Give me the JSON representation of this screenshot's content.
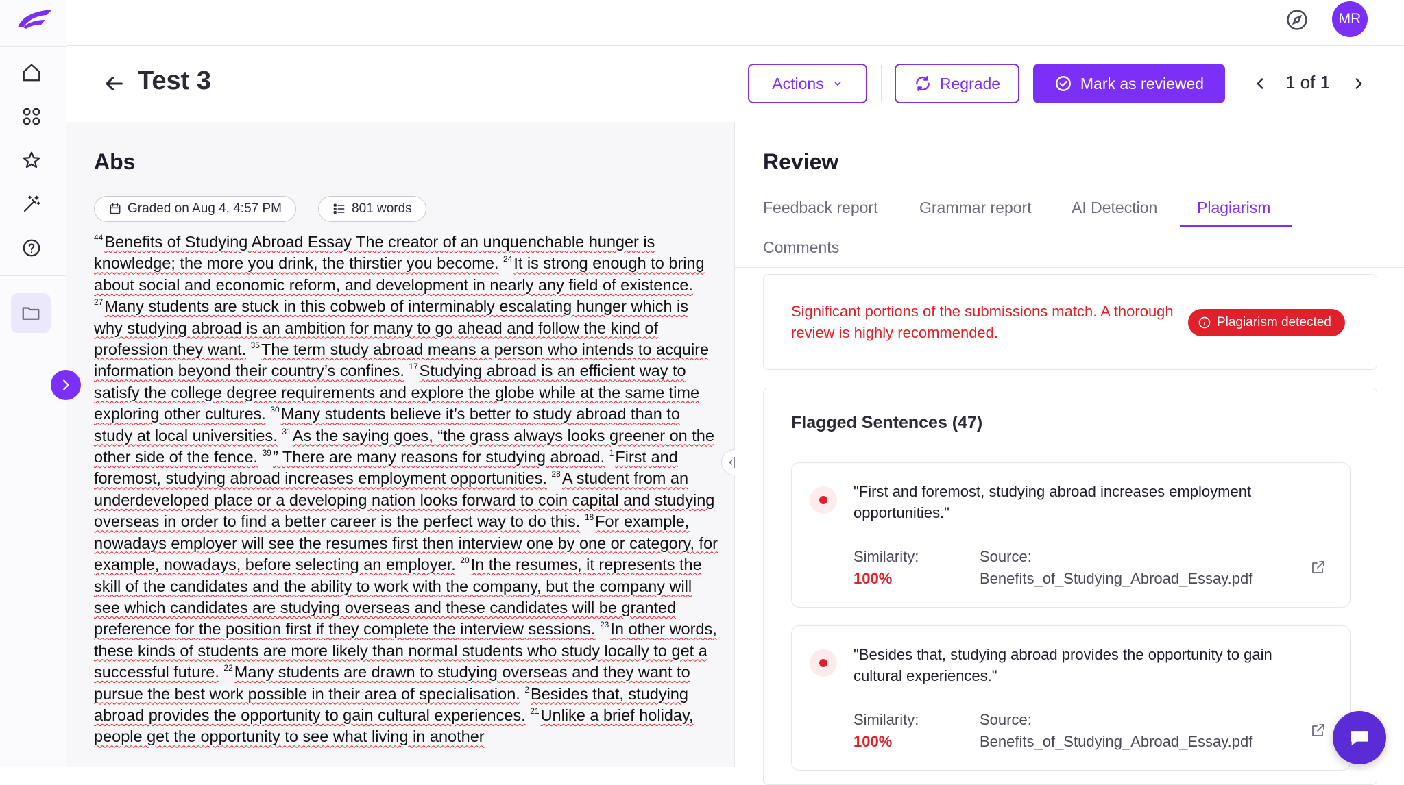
{
  "user": {
    "initials": "MR"
  },
  "header": {
    "title": "Test 3",
    "actions_label": "Actions",
    "regrade_label": "Regrade",
    "mark_reviewed_label": "Mark as reviewed",
    "pager": "1 of 1"
  },
  "essay": {
    "title": "Abs",
    "graded": "Graded on Aug 4, 4:57 PM",
    "words": "801 words",
    "segments": [
      {
        "n": "44",
        "t": "Benefits of Studying Abroad Essay The creator of an unquenchable hunger is knowledge; the more you drink, the thirstier you become."
      },
      {
        "n": "24",
        "t": "It is strong enough to bring about social and economic reform, and development in nearly any field of existence."
      },
      {
        "n": "27",
        "t": "Many students are stuck in this cobweb of interminably escalating hunger which is why studying abroad is an ambition for many to go ahead and follow the kind of profession they want."
      },
      {
        "n": "35",
        "t": "The term study abroad means a person who intends to acquire information beyond their country’s confines."
      },
      {
        "n": "17",
        "t": "Studying abroad is an efficient way to satisfy the college degree requirements and explore the globe while at the same time exploring other cultures."
      },
      {
        "n": "30",
        "t": "Many students believe it’s better to study abroad than to study at local universities."
      },
      {
        "n": "31",
        "t": "As the saying goes, “the grass always looks greener on the other side of the fence."
      },
      {
        "n": "39",
        "t": "” There are many reasons for studying abroad."
      },
      {
        "n": "1",
        "t": "First and foremost, studying abroad increases employment opportunities."
      },
      {
        "n": "28",
        "t": "A student from an underdeveloped place or a developing nation looks forward to coin capital and studying overseas in order to find a better career is the perfect way to do this."
      },
      {
        "n": "18",
        "t": "For example, nowadays employer will see the resumes first then interview one by one or category, for example, nowadays, before selecting an employer."
      },
      {
        "n": "20",
        "t": "In the resumes, it represents the skill of the candidates and the ability to work with the company, but the company will see which candidates are studying overseas and these candidates will be granted preference for the position first if they complete the interview sessions."
      },
      {
        "n": "23",
        "t": "In other words, these kinds of students are more likely than normal students who study locally to get a successful future."
      },
      {
        "n": "22",
        "t": "Many students are drawn to studying overseas and they want to pursue the best work possible in their area of specialisation."
      },
      {
        "n": "2",
        "t": "Besides that, studying abroad provides the opportunity to gain cultural experiences."
      },
      {
        "n": "21",
        "t": "Unlike a brief holiday, people get the opportunity to see what living in another"
      }
    ]
  },
  "review": {
    "title": "Review",
    "tabs": [
      "Feedback report",
      "Grammar report",
      "AI Detection",
      "Plagiarism",
      "Comments"
    ],
    "active_tab": "Plagiarism",
    "alert": {
      "text": "Significant portions of the submissions match. A thorough review is highly recommended.",
      "badge": "Plagiarism detected"
    },
    "flagged_title": "Flagged Sentences (47)",
    "flagged": [
      {
        "quote": "\"First and foremost, studying abroad increases employment opportunities.\"",
        "similarity_label": "Similarity:",
        "similarity": "100%",
        "source_label": "Source:",
        "source": "Benefits_of_Studying_Abroad_Essay.pdf"
      },
      {
        "quote": "\"Besides that, studying abroad provides the opportunity to gain cultural experiences.\"",
        "similarity_label": "Similarity:",
        "similarity": "100%",
        "source_label": "Source:",
        "source": "Benefits_of_Studying_Abroad_Essay.pdf"
      }
    ]
  },
  "colors": {
    "accent": "#7b2ff7",
    "danger": "#e0202a"
  },
  "icons": [
    "logo-icon",
    "home-icon",
    "grid-icon",
    "star-icon",
    "magic-wand-icon",
    "help-icon",
    "folder-icon",
    "chevron-right-icon",
    "compass-icon",
    "arrow-left-icon",
    "chevron-down-icon",
    "refresh-icon",
    "check-circle-icon",
    "chevron-left-icon",
    "calendar-icon",
    "list-icon",
    "split-icon",
    "info-icon",
    "external-link-icon",
    "chat-icon"
  ]
}
